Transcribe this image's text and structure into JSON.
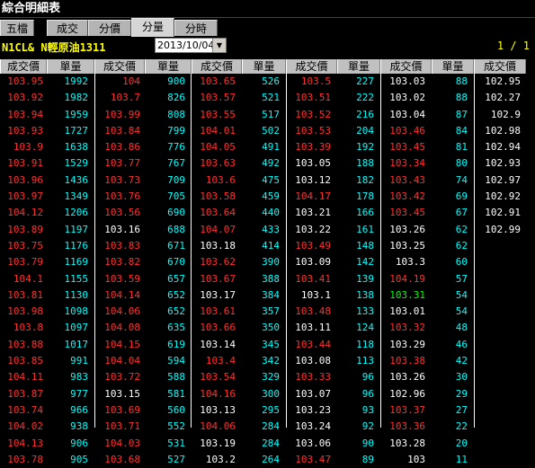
{
  "window": {
    "title": "綜合明細表"
  },
  "tabs": [
    {
      "label": "五檔",
      "active": false
    },
    {
      "label": "成交",
      "active": false
    },
    {
      "label": "分價",
      "active": false
    },
    {
      "label": "分量",
      "active": true
    },
    {
      "label": "分時",
      "active": false
    }
  ],
  "symbol": {
    "code_name": "N1CL&  N輕原油1311"
  },
  "date_select": {
    "value": "2013/10/04"
  },
  "pager": {
    "text": "1 / 1"
  },
  "table": {
    "headers": [
      "成交價",
      "單量",
      "成交價",
      "單量",
      "成交價",
      "單量",
      "成交價",
      "單量",
      "成交價",
      "單量",
      "成交價"
    ],
    "colors": {
      "up": "#ff3030",
      "flat": "#ffffff",
      "volume": "#00ffff",
      "highlight": "#00ff00"
    },
    "columns": [
      [
        {
          "p": "103.95",
          "v": "1992",
          "c": "red"
        },
        {
          "p": "103.92",
          "v": "1982",
          "c": "red"
        },
        {
          "p": "103.94",
          "v": "1959",
          "c": "red"
        },
        {
          "p": "103.93",
          "v": "1727",
          "c": "red"
        },
        {
          "p": "103.9",
          "v": "1638",
          "c": "red"
        },
        {
          "p": "103.91",
          "v": "1529",
          "c": "red"
        },
        {
          "p": "103.96",
          "v": "1436",
          "c": "red"
        },
        {
          "p": "103.97",
          "v": "1349",
          "c": "red"
        },
        {
          "p": "104.12",
          "v": "1206",
          "c": "red"
        },
        {
          "p": "103.89",
          "v": "1197",
          "c": "red"
        },
        {
          "p": "103.75",
          "v": "1176",
          "c": "red"
        },
        {
          "p": "103.79",
          "v": "1169",
          "c": "red"
        },
        {
          "p": "104.1",
          "v": "1155",
          "c": "red"
        },
        {
          "p": "103.81",
          "v": "1130",
          "c": "red"
        },
        {
          "p": "103.98",
          "v": "1098",
          "c": "red"
        },
        {
          "p": "103.8",
          "v": "1097",
          "c": "red"
        },
        {
          "p": "103.88",
          "v": "1017",
          "c": "red"
        },
        {
          "p": "103.85",
          "v": "991",
          "c": "red"
        },
        {
          "p": "104.11",
          "v": "983",
          "c": "red"
        },
        {
          "p": "103.87",
          "v": "977",
          "c": "red"
        },
        {
          "p": "103.74",
          "v": "966",
          "c": "red"
        },
        {
          "p": "104.02",
          "v": "938",
          "c": "red"
        },
        {
          "p": "104.13",
          "v": "906",
          "c": "red"
        },
        {
          "p": "103.78",
          "v": "905",
          "c": "red"
        }
      ],
      [
        {
          "p": "104",
          "v": "900",
          "c": "red"
        },
        {
          "p": "103.7",
          "v": "826",
          "c": "red"
        },
        {
          "p": "103.99",
          "v": "808",
          "c": "red"
        },
        {
          "p": "103.84",
          "v": "799",
          "c": "red"
        },
        {
          "p": "103.86",
          "v": "776",
          "c": "red"
        },
        {
          "p": "103.77",
          "v": "767",
          "c": "red"
        },
        {
          "p": "103.73",
          "v": "709",
          "c": "red"
        },
        {
          "p": "103.76",
          "v": "705",
          "c": "red"
        },
        {
          "p": "103.56",
          "v": "690",
          "c": "red"
        },
        {
          "p": "103.16",
          "v": "688",
          "c": "white"
        },
        {
          "p": "103.83",
          "v": "671",
          "c": "red"
        },
        {
          "p": "103.82",
          "v": "670",
          "c": "red"
        },
        {
          "p": "103.59",
          "v": "657",
          "c": "red"
        },
        {
          "p": "104.14",
          "v": "652",
          "c": "red"
        },
        {
          "p": "104.06",
          "v": "652",
          "c": "red"
        },
        {
          "p": "104.08",
          "v": "635",
          "c": "red"
        },
        {
          "p": "104.15",
          "v": "619",
          "c": "red"
        },
        {
          "p": "104.04",
          "v": "594",
          "c": "red"
        },
        {
          "p": "103.72",
          "v": "588",
          "c": "red"
        },
        {
          "p": "103.15",
          "v": "581",
          "c": "white"
        },
        {
          "p": "103.69",
          "v": "560",
          "c": "red"
        },
        {
          "p": "103.71",
          "v": "552",
          "c": "red"
        },
        {
          "p": "104.03",
          "v": "531",
          "c": "red"
        },
        {
          "p": "103.68",
          "v": "527",
          "c": "red"
        }
      ],
      [
        {
          "p": "103.65",
          "v": "526",
          "c": "red"
        },
        {
          "p": "103.57",
          "v": "521",
          "c": "red"
        },
        {
          "p": "103.55",
          "v": "517",
          "c": "red"
        },
        {
          "p": "104.01",
          "v": "502",
          "c": "red"
        },
        {
          "p": "104.05",
          "v": "491",
          "c": "red"
        },
        {
          "p": "103.63",
          "v": "492",
          "c": "red"
        },
        {
          "p": "103.6",
          "v": "475",
          "c": "red"
        },
        {
          "p": "103.58",
          "v": "459",
          "c": "red"
        },
        {
          "p": "103.64",
          "v": "440",
          "c": "red"
        },
        {
          "p": "104.07",
          "v": "433",
          "c": "red"
        },
        {
          "p": "103.18",
          "v": "414",
          "c": "white"
        },
        {
          "p": "103.62",
          "v": "390",
          "c": "red"
        },
        {
          "p": "103.67",
          "v": "388",
          "c": "red"
        },
        {
          "p": "103.17",
          "v": "384",
          "c": "white"
        },
        {
          "p": "103.61",
          "v": "357",
          "c": "red"
        },
        {
          "p": "103.66",
          "v": "350",
          "c": "red"
        },
        {
          "p": "103.14",
          "v": "345",
          "c": "white"
        },
        {
          "p": "103.4",
          "v": "342",
          "c": "red"
        },
        {
          "p": "103.54",
          "v": "329",
          "c": "red"
        },
        {
          "p": "104.16",
          "v": "300",
          "c": "red"
        },
        {
          "p": "103.13",
          "v": "295",
          "c": "white"
        },
        {
          "p": "104.06",
          "v": "284",
          "c": "red"
        },
        {
          "p": "103.19",
          "v": "284",
          "c": "white"
        },
        {
          "p": "103.2",
          "v": "264",
          "c": "white"
        }
      ],
      [
        {
          "p": "103.5",
          "v": "227",
          "c": "red"
        },
        {
          "p": "103.51",
          "v": "222",
          "c": "red"
        },
        {
          "p": "103.52",
          "v": "216",
          "c": "red"
        },
        {
          "p": "103.53",
          "v": "204",
          "c": "red"
        },
        {
          "p": "103.39",
          "v": "192",
          "c": "red"
        },
        {
          "p": "103.05",
          "v": "188",
          "c": "white"
        },
        {
          "p": "103.12",
          "v": "182",
          "c": "white"
        },
        {
          "p": "104.17",
          "v": "178",
          "c": "red"
        },
        {
          "p": "103.21",
          "v": "166",
          "c": "white"
        },
        {
          "p": "103.22",
          "v": "161",
          "c": "white"
        },
        {
          "p": "103.49",
          "v": "148",
          "c": "red"
        },
        {
          "p": "103.09",
          "v": "142",
          "c": "white"
        },
        {
          "p": "103.41",
          "v": "139",
          "c": "red"
        },
        {
          "p": "103.1",
          "v": "138",
          "c": "white"
        },
        {
          "p": "103.48",
          "v": "133",
          "c": "red"
        },
        {
          "p": "103.11",
          "v": "124",
          "c": "white"
        },
        {
          "p": "103.44",
          "v": "118",
          "c": "red"
        },
        {
          "p": "103.08",
          "v": "113",
          "c": "white"
        },
        {
          "p": "103.33",
          "v": "96",
          "c": "red"
        },
        {
          "p": "103.07",
          "v": "96",
          "c": "white"
        },
        {
          "p": "103.23",
          "v": "93",
          "c": "white"
        },
        {
          "p": "103.24",
          "v": "92",
          "c": "white"
        },
        {
          "p": "103.06",
          "v": "90",
          "c": "white"
        },
        {
          "p": "103.47",
          "v": "89",
          "c": "red"
        }
      ],
      [
        {
          "p": "103.03",
          "v": "88",
          "c": "white"
        },
        {
          "p": "103.02",
          "v": "88",
          "c": "white"
        },
        {
          "p": "103.04",
          "v": "87",
          "c": "white"
        },
        {
          "p": "103.46",
          "v": "84",
          "c": "red"
        },
        {
          "p": "103.45",
          "v": "81",
          "c": "red"
        },
        {
          "p": "103.34",
          "v": "80",
          "c": "red"
        },
        {
          "p": "103.43",
          "v": "74",
          "c": "red"
        },
        {
          "p": "103.42",
          "v": "69",
          "c": "red"
        },
        {
          "p": "103.45",
          "v": "67",
          "c": "red"
        },
        {
          "p": "103.26",
          "v": "62",
          "c": "white"
        },
        {
          "p": "103.25",
          "v": "62",
          "c": "white"
        },
        {
          "p": "103.3",
          "v": "60",
          "c": "white"
        },
        {
          "p": "104.19",
          "v": "57",
          "c": "red"
        },
        {
          "p": "103.31",
          "v": "54",
          "c": "green"
        },
        {
          "p": "103.01",
          "v": "54",
          "c": "white"
        },
        {
          "p": "103.32",
          "v": "48",
          "c": "red"
        },
        {
          "p": "103.29",
          "v": "46",
          "c": "white"
        },
        {
          "p": "103.38",
          "v": "42",
          "c": "red"
        },
        {
          "p": "103.26",
          "v": "30",
          "c": "white"
        },
        {
          "p": "102.96",
          "v": "29",
          "c": "white"
        },
        {
          "p": "103.37",
          "v": "27",
          "c": "red"
        },
        {
          "p": "103.36",
          "v": "22",
          "c": "red"
        },
        {
          "p": "103.28",
          "v": "20",
          "c": "white"
        },
        {
          "p": "103",
          "v": "11",
          "c": "white"
        }
      ],
      [
        {
          "p": "102.95",
          "v": "",
          "c": "white"
        },
        {
          "p": "102.27",
          "v": "",
          "c": "white"
        },
        {
          "p": "102.9",
          "v": "",
          "c": "white"
        },
        {
          "p": "102.98",
          "v": "",
          "c": "white"
        },
        {
          "p": "102.94",
          "v": "",
          "c": "white"
        },
        {
          "p": "102.93",
          "v": "",
          "c": "white"
        },
        {
          "p": "102.97",
          "v": "",
          "c": "white"
        },
        {
          "p": "102.92",
          "v": "",
          "c": "white"
        },
        {
          "p": "102.91",
          "v": "",
          "c": "white"
        },
        {
          "p": "102.99",
          "v": "",
          "c": "white"
        }
      ]
    ]
  }
}
